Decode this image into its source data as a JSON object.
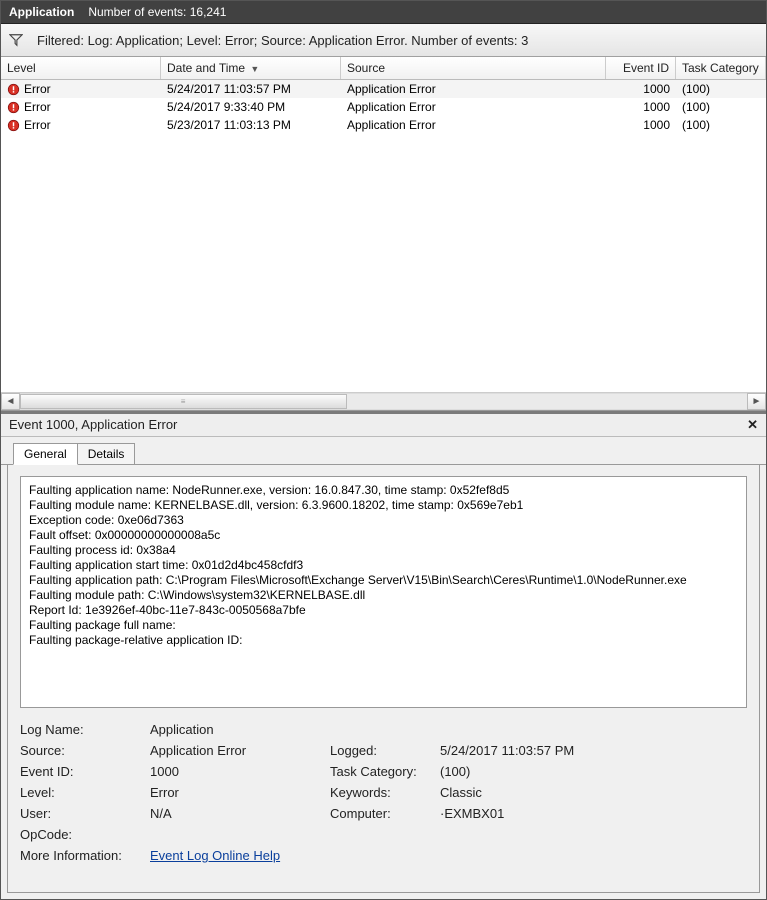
{
  "title": {
    "application_label": "Application",
    "events_count_text": "Number of events: 16,241"
  },
  "filter": {
    "text": "Filtered: Log: Application; Level: Error; Source: Application Error. Number of events: 3"
  },
  "grid": {
    "columns": {
      "level": "Level",
      "date": "Date and Time",
      "source": "Source",
      "eventid": "Event ID",
      "taskcat": "Task Category"
    },
    "rows": [
      {
        "level": "Error",
        "date": "5/24/2017 11:03:57 PM",
        "source": "Application Error",
        "eventid": "1000",
        "taskcat": "(100)"
      },
      {
        "level": "Error",
        "date": "5/24/2017 9:33:40 PM",
        "source": "Application Error",
        "eventid": "1000",
        "taskcat": "(100)"
      },
      {
        "level": "Error",
        "date": "5/23/2017 11:03:13 PM",
        "source": "Application Error",
        "eventid": "1000",
        "taskcat": "(100)"
      }
    ]
  },
  "detail": {
    "header": "Event 1000, Application Error",
    "tabs": {
      "general": "General",
      "details": "Details"
    },
    "event_text": "Faulting application name: NodeRunner.exe, version: 16.0.847.30, time stamp: 0x52fef8d5\nFaulting module name: KERNELBASE.dll, version: 6.3.9600.18202, time stamp: 0x569e7eb1\nException code: 0xe06d7363\nFault offset: 0x00000000000008a5c\nFaulting process id: 0x38a4\nFaulting application start time: 0x01d2d4bc458cfdf3\nFaulting application path: C:\\Program Files\\Microsoft\\Exchange Server\\V15\\Bin\\Search\\Ceres\\Runtime\\1.0\\NodeRunner.exe\nFaulting module path: C:\\Windows\\system32\\KERNELBASE.dll\nReport Id: 1e3926ef-40bc-11e7-843c-0050568a7bfe\nFaulting package full name: \nFaulting package-relative application ID: ",
    "props": {
      "log_name_label": "Log Name:",
      "log_name_value": "Application",
      "source_label": "Source:",
      "source_value": "Application Error",
      "logged_label": "Logged:",
      "logged_value": "5/24/2017 11:03:57 PM",
      "event_id_label": "Event ID:",
      "event_id_value": "1000",
      "task_cat_label": "Task Category:",
      "task_cat_value": "(100)",
      "level_label": "Level:",
      "level_value": "Error",
      "keywords_label": "Keywords:",
      "keywords_value": "Classic",
      "user_label": "User:",
      "user_value": "N/A",
      "computer_label": "Computer:",
      "computer_value": "·EXMBX01",
      "opcode_label": "OpCode:",
      "opcode_value": "",
      "moreinfo_label": "More Information:",
      "moreinfo_link": "Event Log Online Help"
    }
  }
}
